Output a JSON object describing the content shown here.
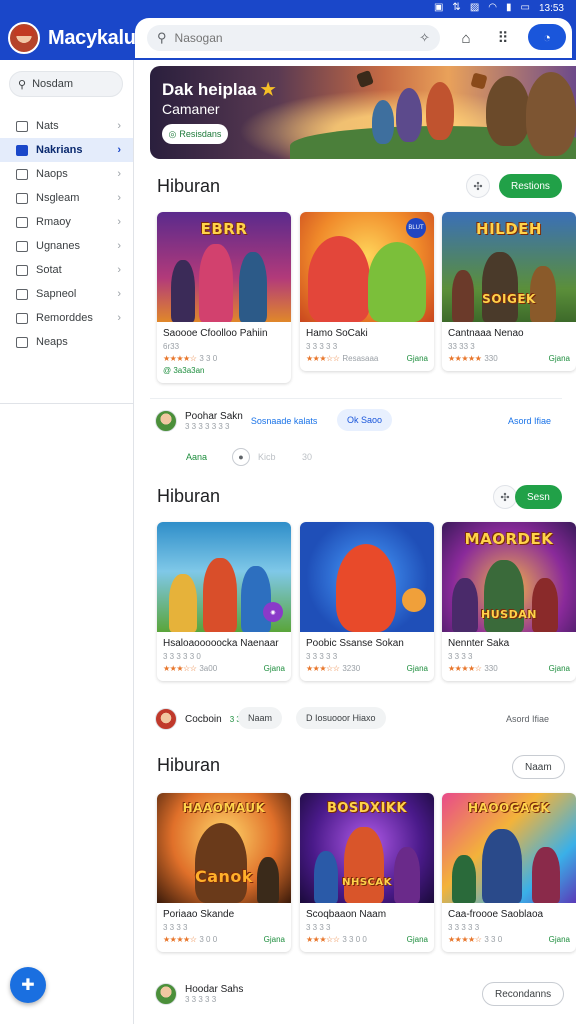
{
  "status": {
    "icons": [
      "sim-icon",
      "data-icon",
      "photo-icon",
      "wifi-icon",
      "signal-icon",
      "battery-icon"
    ],
    "time": "13:53"
  },
  "app": {
    "name": "Macykalu"
  },
  "search": {
    "placeholder": "Nasogan"
  },
  "sidebar": {
    "search_placeholder": "Nosdam",
    "items": [
      {
        "label": "Nats",
        "icon": "home-icon"
      },
      {
        "label": "Nakrians",
        "icon": "grid-icon",
        "active": true
      },
      {
        "label": "Naops",
        "icon": "bag-icon"
      },
      {
        "label": "Nsgleam",
        "icon": "mail-icon"
      },
      {
        "label": "Rmaoy",
        "icon": "doc-icon"
      },
      {
        "label": "Ugnanes",
        "icon": "list-icon"
      },
      {
        "label": "Sotat",
        "icon": "box-icon"
      },
      {
        "label": "Sapneol",
        "icon": "check-icon"
      },
      {
        "label": "Remorddes",
        "icon": "edit-icon"
      },
      {
        "label": "Neaps",
        "icon": "star-icon"
      }
    ]
  },
  "hero": {
    "title": "Dak heiplaa",
    "subtitle": "Camaner",
    "button": "Resisdans"
  },
  "sections": [
    {
      "title": "Hiburan",
      "action": "Restions",
      "cards": [
        {
          "name": "Saoooe Cfoolloo Pahiin",
          "logo": "EBRR",
          "meta": "6r33",
          "rating": "★★★★☆",
          "count": "3 3 0",
          "price": "",
          "extra": "@ 3a3a3an"
        },
        {
          "name": "Hamo SoCaki",
          "logo": "",
          "meta": "3 3 3 3 3",
          "rating": "★★★☆☆",
          "count": "Resasaaa",
          "price": "Gjana",
          "badge": "BLUT"
        },
        {
          "name": "Cantnaaa Nenao",
          "logo": "HILDEH",
          "meta": "33 33 3",
          "rating": "★★★★★",
          "count": "330",
          "price": "Gjana",
          "logo2": "SOIGEK"
        }
      ],
      "author": {
        "name": "Poohar Sakn",
        "sub": "3 3 3 3 3 3 3",
        "link": "Sosnaade kalats",
        "pill": "Ok Saoo",
        "right": "Asord Ifiae",
        "sub_a": "Aana",
        "sub_b": "Kicb",
        "sub_c": "30"
      }
    },
    {
      "title": "Hiburan",
      "action": "Sesn",
      "cards": [
        {
          "name": "Hsaloaooooocka Naenaar",
          "logo": "",
          "meta": "3 3 3 3 3 0",
          "rating": "★★★☆☆",
          "count": "3a00",
          "price": "Gjana"
        },
        {
          "name": "Poobic Ssanse Sokan",
          "logo": "",
          "meta": "3 3 3 3 3",
          "rating": "★★★☆☆",
          "count": "3230",
          "price": "Gjana"
        },
        {
          "name": "Nennter Saka",
          "logo": "MAORDEK",
          "meta": "3 3 3 3",
          "rating": "★★★★☆",
          "count": "330",
          "price": "Gjana",
          "logo2": "HUSDAN"
        }
      ],
      "author": {
        "name": "Cocboin",
        "sub_green": "3 3 1",
        "sub": "Naam",
        "pill": "D Iosuooor Hiaxo",
        "right": "Asord Ifiae"
      }
    },
    {
      "title": "Hiburan",
      "action": "Naam",
      "cards": [
        {
          "name": "Poriaao Skande",
          "logo": "HAAOMAUK",
          "logo2": "Canok",
          "meta": "3 3 3 3",
          "rating": "★★★★☆",
          "count": "3 0 0",
          "price": "Gjana"
        },
        {
          "name": "Scoqbaaon Naam",
          "logo": "BOSDXIKK",
          "logo2": "NHSCAK",
          "meta": "3 3 3 3",
          "rating": "★★★☆☆",
          "count": "3 3 0 0",
          "price": "Gjana"
        },
        {
          "name": "Caa-froooe Saoblaoa",
          "logo": "HAOOGAGK",
          "meta": "3 3 3 3 3",
          "rating": "★★★★☆",
          "count": "3 3 0",
          "price": "Gjana"
        }
      ],
      "author": {
        "name": "Hoodar Sahs",
        "sub": "3 3 3 3 3",
        "pill": "Recondanns"
      }
    }
  ],
  "colors": {
    "brand": "#1a47c9",
    "accent_green": "#21a148",
    "link": "#1a73e8"
  }
}
